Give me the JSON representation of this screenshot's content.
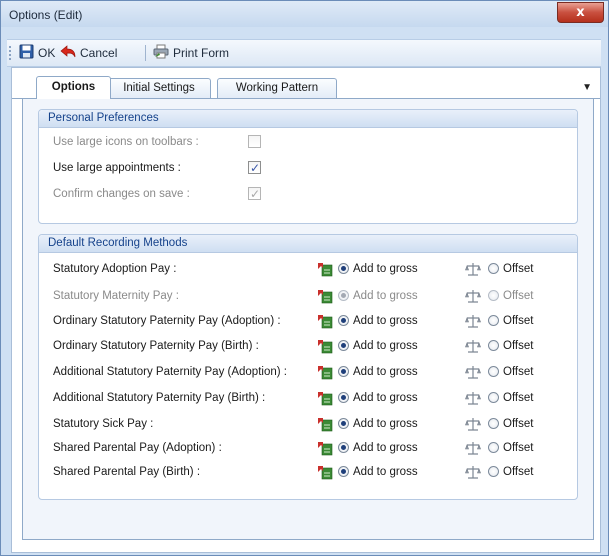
{
  "window": {
    "title": "Options (Edit)",
    "close_label": "x"
  },
  "toolbar": {
    "ok_label": "OK",
    "cancel_label": "Cancel",
    "print_label": "Print Form"
  },
  "tabs": [
    {
      "label": "Options",
      "active": true
    },
    {
      "label": "Initial Settings",
      "active": false
    },
    {
      "label": "Working Pattern",
      "active": false
    }
  ],
  "tab_menu_icon": "dropdown-arrow",
  "personal": {
    "title": "Personal Preferences",
    "items": [
      {
        "label": "Use large icons on toolbars :",
        "checked": false,
        "enabled": false
      },
      {
        "label": "Use large appointments :",
        "checked": true,
        "enabled": true
      },
      {
        "label": "Confirm changes on save :",
        "checked": true,
        "enabled": false
      }
    ]
  },
  "methods": {
    "title": "Default Recording Methods",
    "add_label": "Add to gross",
    "offset_label": "Offset",
    "rows": [
      {
        "label": "Statutory Adoption Pay :",
        "enabled": true,
        "selected": "add"
      },
      {
        "label": "Statutory Maternity Pay :",
        "enabled": false,
        "selected": "add"
      },
      {
        "label": "Ordinary Statutory Paternity Pay (Adoption) :",
        "enabled": true,
        "selected": "add"
      },
      {
        "label": "Ordinary Statutory Paternity Pay (Birth) :",
        "enabled": true,
        "selected": "add"
      },
      {
        "label": "Additional Statutory Paternity Pay (Adoption) :",
        "enabled": true,
        "selected": "add"
      },
      {
        "label": "Additional Statutory Paternity Pay (Birth) :",
        "enabled": true,
        "selected": "add"
      },
      {
        "label": "Statutory Sick Pay :",
        "enabled": true,
        "selected": "add"
      },
      {
        "label": "Shared Parental Pay (Adoption) :",
        "enabled": true,
        "selected": "add"
      },
      {
        "label": "Shared Parental Pay (Birth) :",
        "enabled": true,
        "selected": "add"
      }
    ]
  },
  "colors": {
    "title_bar": "#c6d9ef",
    "close_button": "#c9503f",
    "group_header": "#cfdff2",
    "group_header_text": "#15428b"
  }
}
